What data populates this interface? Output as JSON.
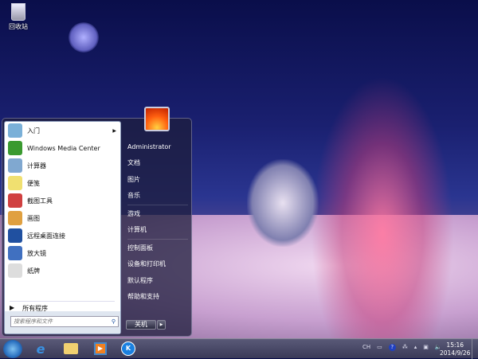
{
  "desktop": {
    "recycle_bin": "回收站"
  },
  "start_menu": {
    "programs": [
      {
        "label": "入门",
        "icon": "getting-started-icon",
        "color": "#7ab0d8",
        "submenu": true
      },
      {
        "label": "Windows Media Center",
        "icon": "media-center-icon",
        "color": "#3a9a30"
      },
      {
        "label": "计算器",
        "icon": "calculator-icon",
        "color": "#80a8d0"
      },
      {
        "label": "便笺",
        "icon": "sticky-notes-icon",
        "color": "#f0e070"
      },
      {
        "label": "截图工具",
        "icon": "snipping-tool-icon",
        "color": "#d04040"
      },
      {
        "label": "画图",
        "icon": "paint-icon",
        "color": "#e0a040"
      },
      {
        "label": "远程桌面连接",
        "icon": "remote-desktop-icon",
        "color": "#2050a0"
      },
      {
        "label": "放大镜",
        "icon": "magnifier-icon",
        "color": "#4070c0"
      },
      {
        "label": "纸牌",
        "icon": "solitaire-icon",
        "color": "#ddd"
      }
    ],
    "all_programs": "所有程序",
    "search_placeholder": "搜索程序和文件",
    "user": "Administrator",
    "right_items": [
      [
        "文档",
        "图片",
        "音乐"
      ],
      [
        "游戏",
        "计算机"
      ],
      [
        "控制面板",
        "设备和打印机",
        "默认程序",
        "帮助和支持"
      ]
    ],
    "shutdown": "关机"
  },
  "taskbar": {
    "pinned": [
      "internet-explorer-icon",
      "windows-explorer-icon",
      "media-player-icon",
      "kugou-icon"
    ],
    "tray": {
      "ime": "CH",
      "help": "?"
    },
    "time": "15:16",
    "date": "2014/9/26"
  }
}
